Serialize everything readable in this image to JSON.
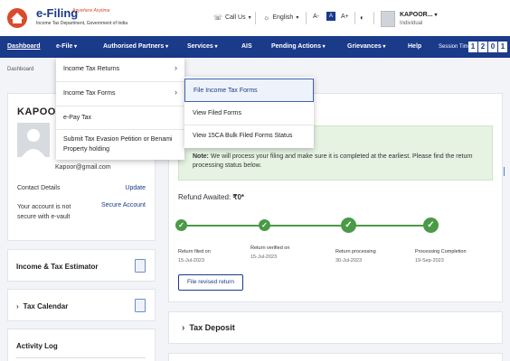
{
  "header": {
    "logo_title": "e-Filing",
    "logo_tagline": "Anywhere Anytime",
    "logo_subtitle": "Income Tax Department, Government of India",
    "call_us": "Call Us",
    "language": "English",
    "font_small": "A-",
    "font_normal": "A",
    "font_large": "A+",
    "user_name": "KAPOOR...",
    "user_role": "Individual"
  },
  "nav": {
    "items": [
      {
        "label": "Dashboard"
      },
      {
        "label": "e-File"
      },
      {
        "label": "Authorised Partners"
      },
      {
        "label": "Services"
      },
      {
        "label": "AIS"
      },
      {
        "label": "Pending Actions"
      },
      {
        "label": "Grievances"
      },
      {
        "label": "Help"
      }
    ],
    "session_label": "Session Time",
    "session_digits": [
      "1",
      "2",
      "0",
      "1"
    ]
  },
  "breadcrumb": "Dashboard",
  "profile": {
    "name": "KAPOOR",
    "email": "Kapoor@gmail.com",
    "contact_label": "Contact Details",
    "update_link": "Update",
    "secure_text": "Your account is not secure with e-vault",
    "secure_link": "Secure Account"
  },
  "left_cards": {
    "estimator": "Income & Tax Estimator",
    "calendar": "Tax Calendar",
    "activity": "Activity Log"
  },
  "efile_menu": {
    "items": [
      {
        "label": "Income Tax Returns",
        "has_submenu": true
      },
      {
        "label": "Income Tax Forms",
        "has_submenu": true
      },
      {
        "label": "e-Pay Tax",
        "has_submenu": false
      },
      {
        "label": "Submit Tax Evasion Petition or Benami",
        "has_submenu": false
      },
      {
        "label": "Property holding",
        "has_submenu": false
      }
    ]
  },
  "forms_submenu": {
    "items": [
      {
        "label": "File Income Tax Forms",
        "highlighted": true
      },
      {
        "label": "View Filed Forms",
        "highlighted": false
      },
      {
        "label": "View 15CA Bulk Filed Forms Status",
        "highlighted": false
      }
    ]
  },
  "status": {
    "note_label": "Note:",
    "note_text": "We will process your filing and make sure it is completed at the earliest. Please find the return processing status below.",
    "refund_label": "Refund Awaited:",
    "refund_value": "₹0*",
    "steps": [
      {
        "label": "Return filed on",
        "date": "15-Jul-2023"
      },
      {
        "label": "Return verified on",
        "date": "15-Jul-2023"
      },
      {
        "label": "Return processing",
        "date": "30-Jul-2023"
      },
      {
        "label": "Processing Completion",
        "date": "19-Sep-2023"
      }
    ],
    "revise_button": "File revised return"
  },
  "tax_deposit": {
    "label": "Tax Deposit"
  },
  "colors": {
    "brand": "#1a3a8a",
    "success": "#4a9a48",
    "note_bg": "#e6f3e3"
  }
}
